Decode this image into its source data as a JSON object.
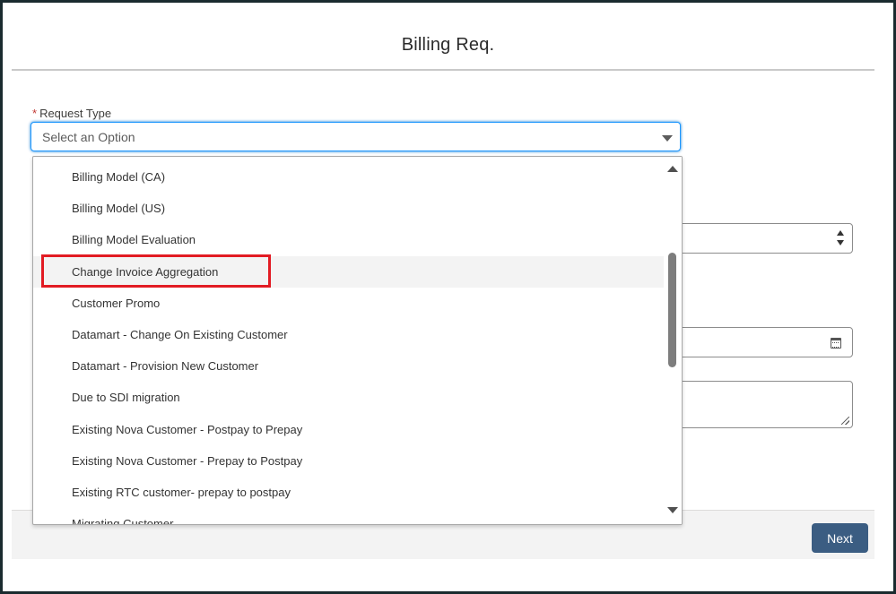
{
  "dialog": {
    "title": "Billing Req."
  },
  "request_type": {
    "label": "Request Type",
    "required_marker": "*",
    "placeholder": "Select an Option",
    "options": [
      "Billing Model (CA)",
      "Billing Model (US)",
      "Billing Model Evaluation",
      "Change Invoice Aggregation",
      "Customer Promo",
      "Datamart - Change On Existing Customer",
      "Datamart - Provision New Customer",
      "Due to SDI migration",
      "Existing Nova Customer - Postpay to Prepay",
      "Existing Nova Customer - Prepay to Postpay",
      "Existing RTC customer- prepay to postpay",
      "Migrating Customer"
    ],
    "hovered_option": "Change Invoice Aggregation"
  },
  "footer": {
    "next_label": "Next"
  },
  "colors": {
    "highlight": "#e21b23",
    "button": "#3b5d82",
    "focus_border": "#1b96ff",
    "required": "#c23934"
  },
  "icons": {
    "combobox": "chevron-down-icon",
    "picklist": "up-down-icon",
    "date": "calendar-icon",
    "textarea": "resize-grip-icon",
    "scroll_up": "scroll-up-arrow-icon",
    "scroll_down": "scroll-down-arrow-icon"
  }
}
